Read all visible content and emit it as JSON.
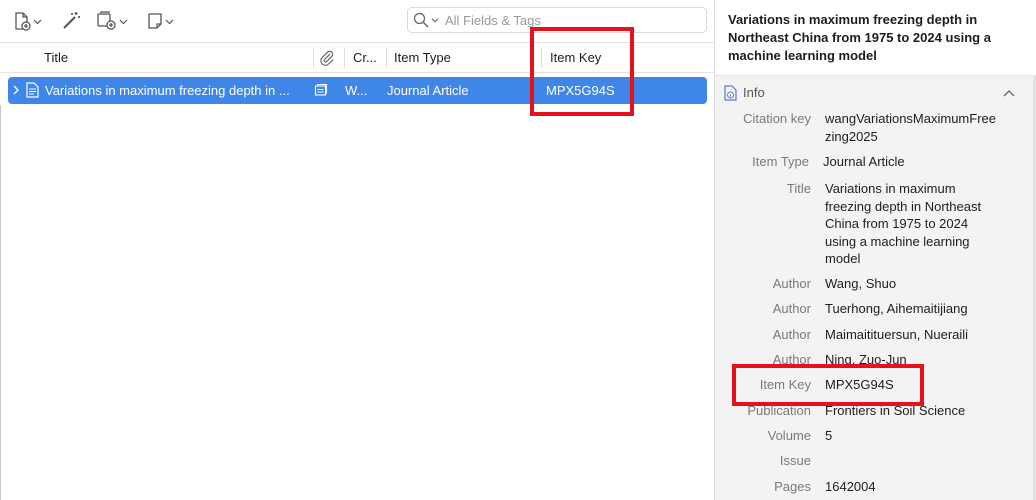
{
  "toolbar": {
    "new_item_icon": "new-item-icon",
    "magic_wand_icon": "add-by-identifier-icon",
    "attachment_icon": "add-attachment-icon",
    "note_icon": "new-note-icon",
    "search_placeholder": "All Fields & Tags",
    "search_value": ""
  },
  "columns": {
    "title": "Title",
    "creator": "Cr...",
    "item_type": "Item Type",
    "item_key": "Item Key"
  },
  "row": {
    "title": "Variations in maximum freezing depth in ...",
    "creator": "W...",
    "item_type": "Journal Article",
    "item_key": "MPX5G94S"
  },
  "item_pane": {
    "title": "Variations in maximum freezing depth in Northeast China from 1975 to 2024 using a machine learning model",
    "section": "Info",
    "fields": [
      {
        "label": "Citation key",
        "value": "wangVariationsMaximumFreezing2025"
      },
      {
        "label": "Item Type",
        "value": "Journal Article"
      },
      {
        "label": "Title",
        "value": "Variations in maximum freezing depth in Northeast China from 1975 to 2024 using a machine learning model"
      },
      {
        "label": "Author",
        "value": "Wang, Shuo"
      },
      {
        "label": "Author",
        "value": "Tuerhong, Aihemaitijiang"
      },
      {
        "label": "Author",
        "value": "Maimaitituersun, Nueraili"
      },
      {
        "label": "Author",
        "value": "Ning, Zuo-Jun"
      },
      {
        "label": "Item Key",
        "value": "MPX5G94S"
      },
      {
        "label": "Publication",
        "value": "Frontiers in Soil Science"
      },
      {
        "label": "Volume",
        "value": "5"
      },
      {
        "label": "Issue",
        "value": ""
      },
      {
        "label": "Pages",
        "value": "1642004"
      }
    ]
  },
  "colors": {
    "selection": "#3e86e8",
    "highlight": "#e3121b"
  }
}
